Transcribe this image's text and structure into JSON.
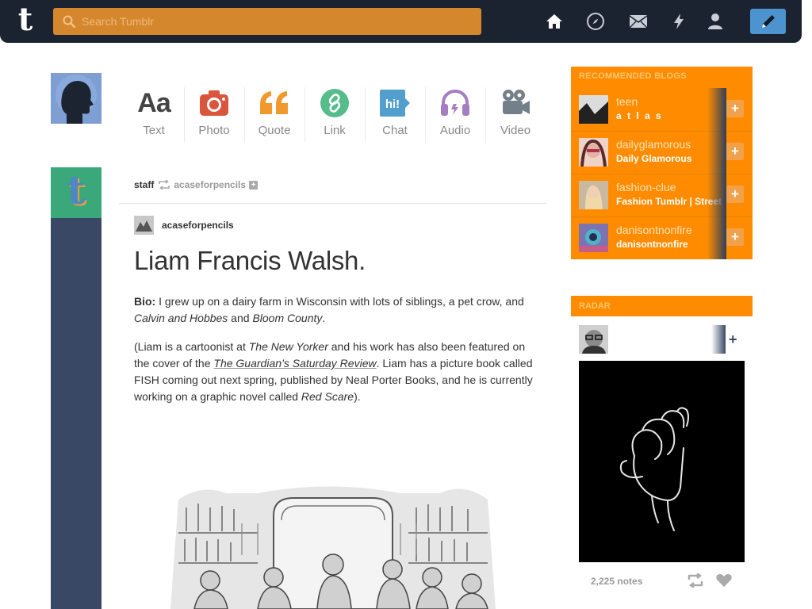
{
  "topbar": {
    "logo": "t",
    "search_placeholder": "Search Tumblr",
    "nav": [
      "home-icon",
      "explore-icon",
      "inbox-icon",
      "activity-icon",
      "account-icon",
      "compose-icon"
    ]
  },
  "post_types": [
    {
      "label": "Text",
      "glyph": "Aa",
      "color": "#444444"
    },
    {
      "label": "Photo",
      "color": "#d9553b"
    },
    {
      "label": "Quote",
      "glyph": "❝",
      "color": "#f2992e"
    },
    {
      "label": "Link",
      "color": "#56bc8a"
    },
    {
      "label": "Chat",
      "glyph": "hi!",
      "color": "#529ecc"
    },
    {
      "label": "Audio",
      "color": "#a77dc2"
    },
    {
      "label": "Video",
      "color": "#748089"
    }
  ],
  "post": {
    "reblogger": "staff",
    "source": "acaseforpencils",
    "source_plus": "+",
    "author": "acaseforpencils",
    "title": "Liam Francis Walsh.",
    "bio_label": "Bio:",
    "bio_text": " I grew up on a dairy farm in Wisconsin with lots of siblings, a pet crow, and ",
    "bio_em1": "Calvin and Hobbes",
    "bio_and": " and ",
    "bio_em2": "Bloom County",
    "bio_end": ".",
    "p2_a": "(Liam is a cartoonist at ",
    "p2_em1": "The New Yorker",
    "p2_b": " and his work has also been featured on the cover of the ",
    "p2_link": "The Guardian’s Saturday Review",
    "p2_c": ". Liam has a picture book called FISH coming out next spring, published by Neal Porter Books, and he is currently working on a graphic novel called ",
    "p2_em2": "Red Scare",
    "p2_d": ")."
  },
  "recommended": {
    "title": "RECOMMENDED BLOGS",
    "items": [
      {
        "name": "teen",
        "sub": "a t l a s",
        "thumb_color": "#5a5a5a"
      },
      {
        "name": "dailyglamorous",
        "sub": "Daily Glamorous",
        "thumb_color": "#b8646a"
      },
      {
        "name": "fashion-clue",
        "sub": "Fashion Tumblr | Street",
        "thumb_color": "#8a7b6c"
      },
      {
        "name": "danisontnonfire",
        "sub": "danisontnonfire",
        "thumb_color": "#7a6aa0"
      }
    ],
    "follow_label": "+"
  },
  "radar": {
    "title": "RADAR",
    "follow_label": "+",
    "notes": "2,225 notes"
  },
  "colors": {
    "accent_orange": "#ff8c00",
    "topbar": "#1b2230",
    "rail": "#394864",
    "compose": "#4c93cf"
  }
}
